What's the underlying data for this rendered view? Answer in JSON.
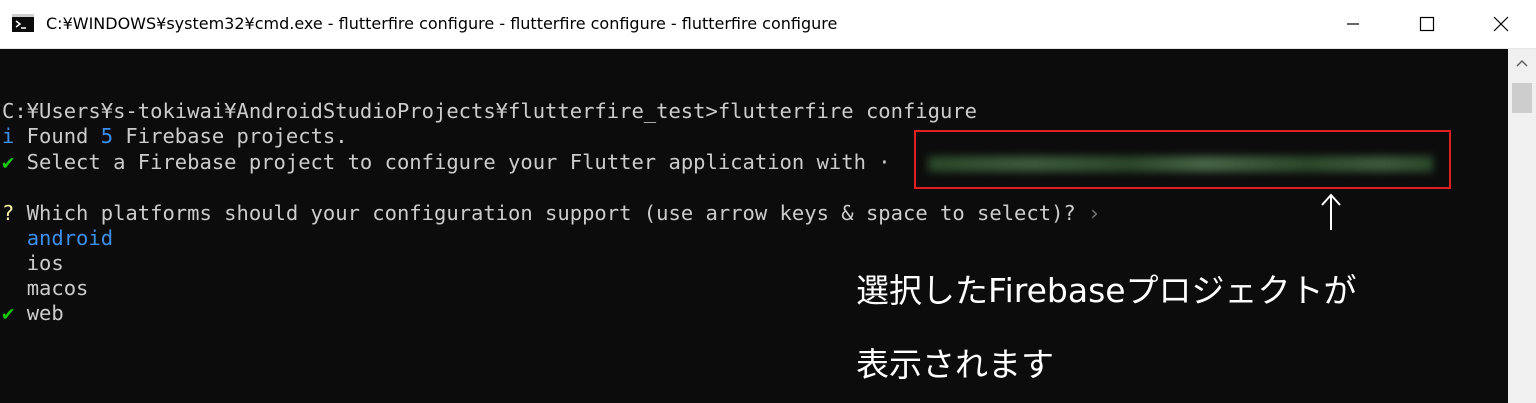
{
  "window": {
    "title": "C:¥WINDOWS¥system32¥cmd.exe - flutterfire  configure - flutterfire  configure - flutterfire  configure",
    "icon": "cmd-icon",
    "controls": [
      "minimize-icon",
      "maximize-icon",
      "close-icon"
    ]
  },
  "terminal": {
    "prompt_line": "C:¥Users¥s-tokiwai¥AndroidStudioProjects¥flutterfire_test>flutterfire configure",
    "found": {
      "prefix": "i",
      "text_a": " Found ",
      "count": "5",
      "text_b": " Firebase projects."
    },
    "select": {
      "check": "✔",
      "text": " Select a Firebase project to configure your Flutter application with ·"
    },
    "question": {
      "mark": "?",
      "text": " Which platforms should your configuration support (use arrow keys & space to select)?",
      "chevron": " ›"
    },
    "platforms": [
      {
        "label": "android",
        "selected": false,
        "highlighted": true
      },
      {
        "label": "ios",
        "selected": false,
        "highlighted": false
      },
      {
        "label": "macos",
        "selected": false,
        "highlighted": false
      },
      {
        "label": "web",
        "selected": true,
        "highlighted": false,
        "check": "✔"
      }
    ]
  },
  "annotation": {
    "line1": "選択したFirebaseプロジェクトが",
    "line2": "表示されます",
    "arrow": "↑",
    "box_color": "#e02020"
  },
  "colors": {
    "background": "#0c0c0c",
    "text": "#cccccc",
    "blue": "#3b8eea",
    "green": "#16c60c",
    "yellow": "#f9f1a5"
  }
}
